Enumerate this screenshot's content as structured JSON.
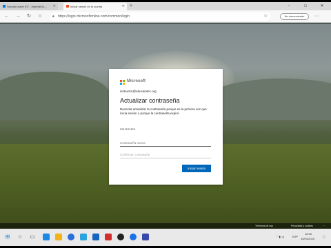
{
  "browser": {
    "tabs": [
      {
        "label": "Sección clave VIT - InformeGo..."
      },
      {
        "label": "Iniciar sesión en la cuenta"
      }
    ],
    "new_tab": "+",
    "window_controls": {
      "minimize": "–",
      "maximize": "□",
      "close": "✕"
    },
    "url": "https://login.microsoftonline.com/common/login",
    "account_button": "No sincronizado",
    "menu": "···"
  },
  "dialog": {
    "brand": "Microsoft",
    "identity": "instructor@educaintec.org",
    "title": "Actualizar contraseña",
    "description": "Necesita actualizar la contraseña porque es la primera vez que inicia sesión o porque la contraseña expiró.",
    "current_password": "••••••••••",
    "new_password_placeholder": "Contraseña nueva",
    "confirm_password_placeholder": "Confirmar contraseña",
    "sign_in_button": "Iniciar sesión"
  },
  "footer": {
    "terms": "Términos de uso",
    "privacy": "Privacidad y cookies",
    "more": "···"
  },
  "taskbar": {
    "language": "ESP",
    "time": "18:35",
    "date": "15/04/2020"
  },
  "colors": {
    "accent": "#0067b8",
    "logo_red": "#f25022",
    "logo_green": "#7fba00",
    "logo_blue": "#00a4ef",
    "logo_yellow": "#ffb900"
  }
}
